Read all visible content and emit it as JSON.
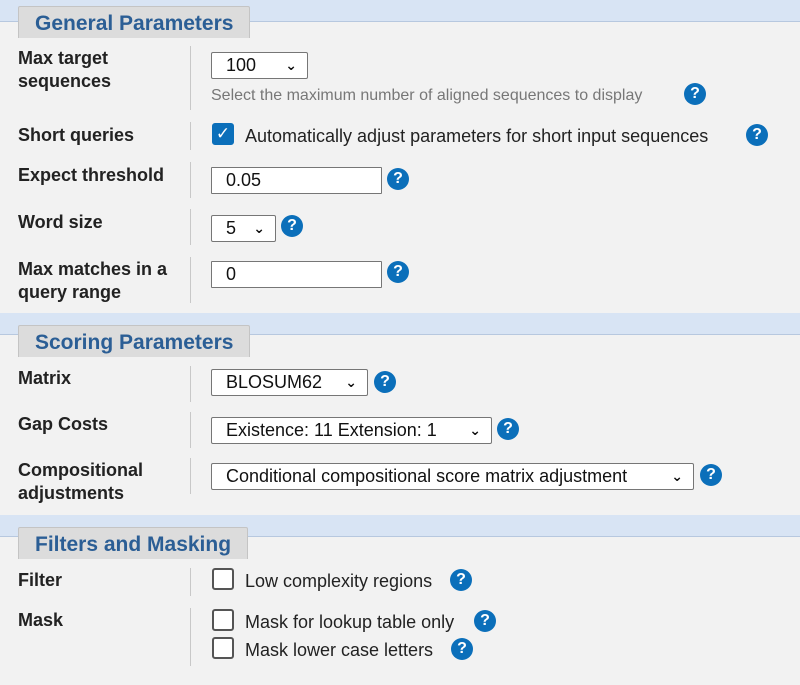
{
  "sections": {
    "general": {
      "title": "General Parameters",
      "max_target": {
        "label": "Max target sequences",
        "value": "100",
        "hint": "Select the maximum number of aligned sequences to display"
      },
      "short_queries": {
        "label": "Short queries",
        "checkbox_label": "Automatically adjust parameters for short input sequences",
        "checked": true
      },
      "expect": {
        "label": "Expect threshold",
        "value": "0.05"
      },
      "word_size": {
        "label": "Word size",
        "value": "5"
      },
      "max_matches": {
        "label": "Max matches in a query range",
        "value": "0"
      }
    },
    "scoring": {
      "title": "Scoring Parameters",
      "matrix": {
        "label": "Matrix",
        "value": "BLOSUM62"
      },
      "gap_costs": {
        "label": "Gap Costs",
        "value": "Existence: 11 Extension: 1"
      },
      "compositional": {
        "label": "Compositional adjustments",
        "value": "Conditional compositional score matrix adjustment"
      }
    },
    "filters": {
      "title": "Filters and Masking",
      "filter": {
        "label": "Filter",
        "option": "Low complexity regions",
        "checked": false
      },
      "mask": {
        "label": "Mask",
        "options": [
          "Mask for lookup table only",
          "Mask lower case letters"
        ],
        "checked": [
          false,
          false
        ]
      }
    }
  },
  "icons": {
    "help": "question-circle-icon",
    "chevron": "chevron-down-icon",
    "check": "checkmark-icon"
  },
  "glyphs": {
    "help": "?",
    "chevron": "⌄",
    "check": "✓"
  },
  "colors": {
    "accent": "#0b6fba",
    "section_title": "#2b5e95",
    "band": "#d8e4f4"
  }
}
